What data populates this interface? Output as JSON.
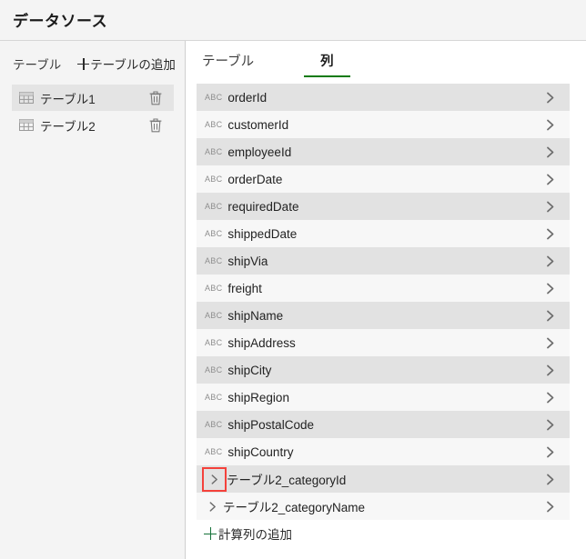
{
  "header": {
    "title": "データソース"
  },
  "sidebar": {
    "section_label": "テーブル",
    "add_table_label": "テーブルの追加",
    "add_table_icon": "plus-icon",
    "items": [
      {
        "label": "テーブル1",
        "icon": "table-grid-icon",
        "delete_icon": "trash-icon",
        "selected": true
      },
      {
        "label": "テーブル2",
        "icon": "table-grid-icon",
        "delete_icon": "trash-icon",
        "selected": false
      }
    ]
  },
  "main": {
    "tabs": [
      {
        "label": "テーブル",
        "active": false
      },
      {
        "label": "列",
        "active": true
      }
    ],
    "active_tab_underline_color": "#0b7a0b",
    "type_icon_label": "ABC",
    "rows": [
      {
        "label": "orderId",
        "type_icon": "abc-icon",
        "chevron": "chevron-right-icon",
        "expandable": false,
        "shaded": true
      },
      {
        "label": "customerId",
        "type_icon": "abc-icon",
        "chevron": "chevron-right-icon",
        "expandable": false,
        "shaded": false
      },
      {
        "label": "employeeId",
        "type_icon": "abc-icon",
        "chevron": "chevron-right-icon",
        "expandable": false,
        "shaded": true
      },
      {
        "label": "orderDate",
        "type_icon": "abc-icon",
        "chevron": "chevron-right-icon",
        "expandable": false,
        "shaded": false
      },
      {
        "label": "requiredDate",
        "type_icon": "abc-icon",
        "chevron": "chevron-right-icon",
        "expandable": false,
        "shaded": true
      },
      {
        "label": "shippedDate",
        "type_icon": "abc-icon",
        "chevron": "chevron-right-icon",
        "expandable": false,
        "shaded": false
      },
      {
        "label": "shipVia",
        "type_icon": "abc-icon",
        "chevron": "chevron-right-icon",
        "expandable": false,
        "shaded": true
      },
      {
        "label": "freight",
        "type_icon": "abc-icon",
        "chevron": "chevron-right-icon",
        "expandable": false,
        "shaded": false
      },
      {
        "label": "shipName",
        "type_icon": "abc-icon",
        "chevron": "chevron-right-icon",
        "expandable": false,
        "shaded": true
      },
      {
        "label": "shipAddress",
        "type_icon": "abc-icon",
        "chevron": "chevron-right-icon",
        "expandable": false,
        "shaded": false
      },
      {
        "label": "shipCity",
        "type_icon": "abc-icon",
        "chevron": "chevron-right-icon",
        "expandable": false,
        "shaded": true
      },
      {
        "label": "shipRegion",
        "type_icon": "abc-icon",
        "chevron": "chevron-right-icon",
        "expandable": false,
        "shaded": false
      },
      {
        "label": "shipPostalCode",
        "type_icon": "abc-icon",
        "chevron": "chevron-right-icon",
        "expandable": false,
        "shaded": true
      },
      {
        "label": "shipCountry",
        "type_icon": "abc-icon",
        "chevron": "chevron-right-icon",
        "expandable": false,
        "shaded": false
      },
      {
        "label": "テーブル2_categoryId",
        "type_icon": null,
        "chevron": "chevron-right-icon",
        "expandable": true,
        "shaded": true,
        "highlighted": true
      },
      {
        "label": "テーブル2_categoryName",
        "type_icon": null,
        "chevron": "chevron-right-icon",
        "expandable": true,
        "shaded": false,
        "highlighted": false
      }
    ],
    "add_calculated_column_label": "計算列の追加",
    "add_calculated_column_icon": "plus-icon",
    "highlight_color": "#f4413b"
  }
}
